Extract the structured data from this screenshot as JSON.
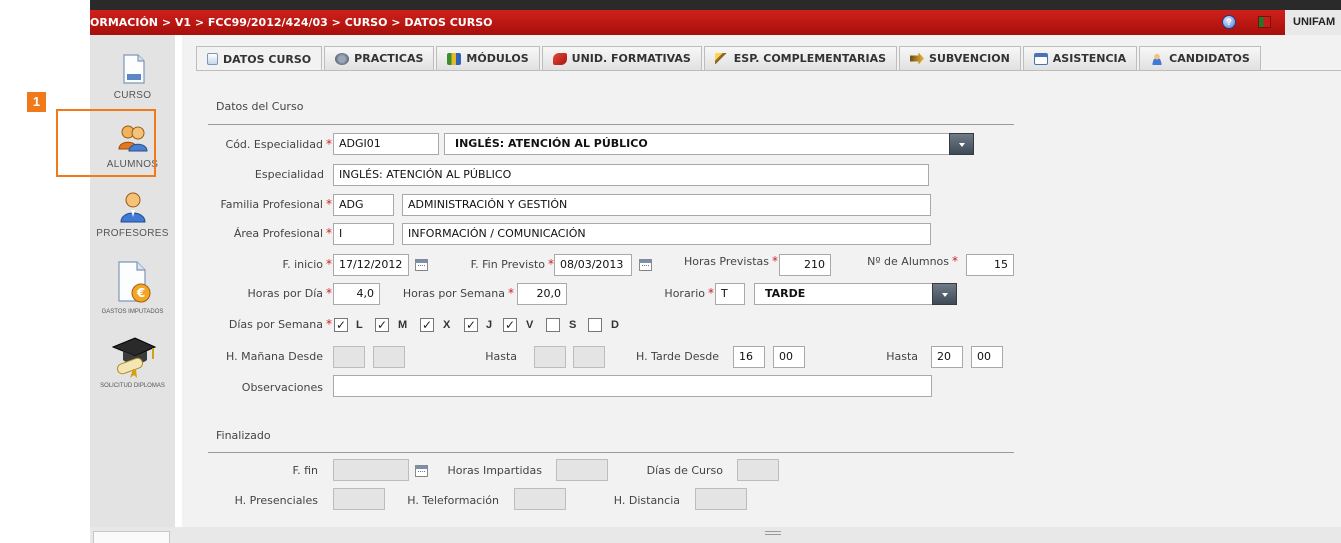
{
  "step_badge": "1",
  "topbar": {
    "breadcrumb": "ORMACIÓN > V1 > FCC99/2012/424/03 > CURSO > DATOS CURSO",
    "user": "UNIFAM"
  },
  "sidebar": {
    "items": [
      {
        "label": "CURSO",
        "icon": "document-icon"
      },
      {
        "label": "ALUMNOS",
        "icon": "users-icon"
      },
      {
        "label": "PROFESORES",
        "icon": "teacher-icon"
      },
      {
        "label": "GASTOS IMPUTADOS",
        "icon": "expenses-icon"
      },
      {
        "label": "SOLICITUD DIPLOMAS",
        "icon": "diploma-icon"
      }
    ]
  },
  "tabs": [
    {
      "label": "DATOS CURSO",
      "icon": "document-icon",
      "active": true
    },
    {
      "label": "PRACTICAS",
      "icon": "gears-icon"
    },
    {
      "label": "MÓDULOS",
      "icon": "books-icon"
    },
    {
      "label": "UNID. FORMATIVAS",
      "icon": "pencil-icon"
    },
    {
      "label": "ESP. COMPLEMENTARIAS",
      "icon": "wand-icon"
    },
    {
      "label": "SUBVENCION",
      "icon": "arrow-icon"
    },
    {
      "label": "ASISTENCIA",
      "icon": "checklist-icon"
    },
    {
      "label": "CANDIDATOS",
      "icon": "user-search-icon"
    }
  ],
  "form": {
    "section_title": "Datos del Curso",
    "cod_especialidad": {
      "label": "Cód. Especialidad",
      "code": "ADGI01",
      "name": "INGLÉS: ATENCIÓN AL PÚBLICO"
    },
    "especialidad": {
      "label": "Especialidad",
      "value": "INGLÉS: ATENCIÓN AL PÚBLICO"
    },
    "familia_profesional": {
      "label": "Familia Profesional",
      "code": "ADG",
      "name": "ADMINISTRACIÓN Y GESTIÓN"
    },
    "area_profesional": {
      "label": "Área Profesional",
      "code": "I",
      "name": "INFORMACIÓN / COMUNICACIÓN"
    },
    "f_inicio": {
      "label": "F. inicio",
      "value": "17/12/2012"
    },
    "f_fin_previsto": {
      "label": "F. Fin Previsto",
      "value": "08/03/2013"
    },
    "horas_previstas": {
      "label": "Horas Previstas",
      "value": "210"
    },
    "num_alumnos": {
      "label": "Nº de Alumnos",
      "value": "15"
    },
    "horas_por_dia": {
      "label": "Horas por Día",
      "value": "4,0"
    },
    "horas_por_semana": {
      "label": "Horas por Semana",
      "value": "20,0"
    },
    "horario": {
      "label": "Horario",
      "code": "T",
      "name": "TARDE"
    },
    "dias_por_semana": {
      "label": "Días por Semana",
      "days": [
        {
          "label": "L",
          "checked": true
        },
        {
          "label": "M",
          "checked": true
        },
        {
          "label": "X",
          "checked": true
        },
        {
          "label": "J",
          "checked": true
        },
        {
          "label": "V",
          "checked": true
        },
        {
          "label": "S",
          "checked": false
        },
        {
          "label": "D",
          "checked": false
        }
      ]
    },
    "h_manana_desde": {
      "label": "H. Mañana Desde",
      "hh": "",
      "mm": ""
    },
    "hasta_manana": {
      "label": "Hasta",
      "hh": "",
      "mm": ""
    },
    "h_tarde_desde": {
      "label": "H. Tarde Desde",
      "hh": "16",
      "mm": "00"
    },
    "hasta_tarde": {
      "label": "Hasta",
      "hh": "20",
      "mm": "00"
    },
    "observaciones": {
      "label": "Observaciones",
      "value": ""
    }
  },
  "finalizado": {
    "section_title": "Finalizado",
    "f_fin": {
      "label": "F. fin",
      "value": ""
    },
    "horas_impartidas": {
      "label": "Horas Impartidas",
      "value": ""
    },
    "dias_de_curso": {
      "label": "Días de Curso",
      "value": ""
    },
    "h_presenciales": {
      "label": "H. Presenciales",
      "value": ""
    },
    "h_teleformacion": {
      "label": "H. Teleformación",
      "value": ""
    },
    "h_distancia": {
      "label": "H. Distancia",
      "value": ""
    }
  },
  "colors": {
    "topbar": "#c0181a",
    "required": "#d0201a",
    "highlight": "#f07a1a",
    "panel": "#e3e3e3"
  }
}
